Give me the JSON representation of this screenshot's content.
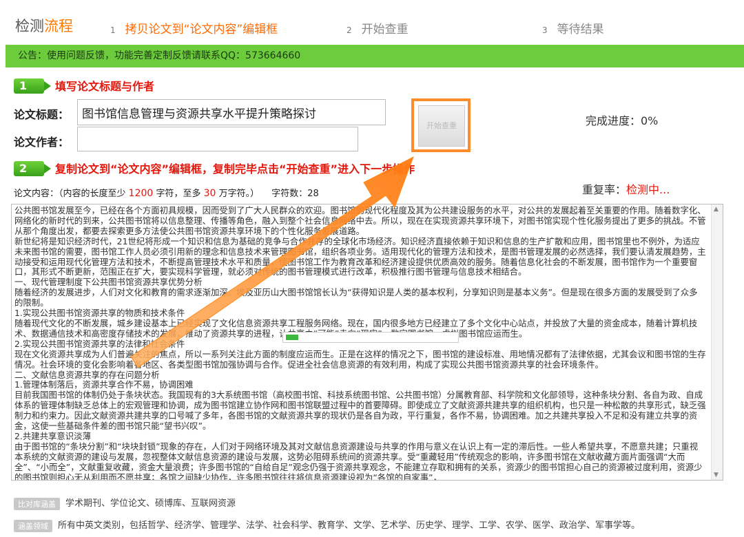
{
  "header": {
    "brand_part1": "检测",
    "brand_part2": "流程",
    "steps": [
      {
        "num": "1",
        "label": "拷贝论文到“论文内容”编辑框"
      },
      {
        "num": "2",
        "label": "开始查重"
      },
      {
        "num": "3",
        "label": "等待结果"
      }
    ]
  },
  "notice": "公告：使用问题反馈，功能完善定制反馈请联系QQ：573664660",
  "section1": {
    "num": "1",
    "title": "填写论文标题与作者"
  },
  "form": {
    "title_label": "论文标题：",
    "title_value": "图书馆信息管理与资源共享水平提升策略探讨",
    "author_label": "论文作者：",
    "author_value": ""
  },
  "start_button": "开始查重",
  "progress_text": "完成进度：0%",
  "section2": {
    "num": "2",
    "title": "复制论文到“论文内容”编辑框，复制完毕点击“开始查重”进入下一步操作"
  },
  "repeat": {
    "label": "重复率：",
    "value": "检测中..."
  },
  "content_info": {
    "prefix": "论文内容：（内容的长度至少",
    "min": "1200",
    "mid": "字符，至多",
    "max": "30",
    "suffix": "万字符。）",
    "count_label": "字符数：28"
  },
  "content_text": "公共图书馆发展至今，已经在各个方面初具规模，因而受到了广大人民群众的欢迎。图书馆的现代化程度及其为公共建设服务的水平，对公共的发展起着至关重要的作用。随着数字化、网络化的新时代的到来，公共图书馆将以信息整理、传播等角色，融入到整个社会信息网络中去。所以，现在在实现资源共享环境下，对图书馆实现个性化服务提出了更多的挑战。不管从那个角度出发，都要去探索更多方法使公共图书馆资源共享环境下的个性化服务发展道路。\n新世纪将是知识经济时代，21世纪将形成一个知识和信息为基础的竞争与合作并存的全球化市场经济。知识经济直接依赖于知识和信息的生产扩散和应用，图书馆里也不例外，为适应未来图书馆的需要，图书馆工作人员必须引用新的理念和信息技术来管理图书馆，组织各项业务。适用现代化的管理方法和技术，是图书管理发展的必然选择，我们要认清发展趋势，主动接受和运用现代化管理方法和技术，不断提高管理技术水平和质量，使图书馆工作为教育改革和经济建设提供优质高效的服务。随着信息化社会的不断发展，图书馆作为一个重要窗口，其形式不断更新，范围正在扩大，要实现科学管理，就必须对传统的图书管理模式进行改革，积极推行图书管理与信息技术相结合。\n一、现代管理制度下公共图书馆资源共享优势分析\n随着经济的发展进步，人们对文化和教育的需求逐渐加深。埃及亚历山大图书馆馆长认为“获得知识是人类的基本权利，分享知识则是基本义务”。但是现在很多方面的发展受到了众多的限制。\n1.实现公共图书馆资源共享的物质和技术条件\n随着现代文化的不断发展，城乡建设基本上已经实现了文化信息资源共享工程服务网络。现在，国内很多地方已经建立了多个文化中心站点，并投放了大量的资金成本，随着计算机技术、数据通信技术和高密度存储技术的发展，推动了资源共享的进程，让共享由“可能”走向“现实”，数字图书馆、虚拟图书馆应运而生。\n2.实现公共图书馆资源共享的法律和社会条件\n现在文化资源共享成为人们普遍关注的焦点，所以一系列关注此方面的制度应运而生。正是在这样的情况之下，图书馆的建设标准、用地情况都有了法律依据，尤其会议和图书馆的生存情况。社会环境的变化会影响着各地区、各类型图书馆加强协调与合作。促进全社会信息资源的有效利用，构成了实现公共图书馆资源共享的社会环境条件。\n二、文献信息资源共享的存在问题分析\n1.管理体制落后，资源共享合作不易，协调困难\n目前我国图书馆的体制仍处于条块状态。我国现有的3大系统图书馆（高校图书馆、科技系统图书馆、公共图书馆）分属教育部、科学院和文化部领导，这种条块分割、各自为政、自成体系的管理体制缺乏总体上的宏观管理和协调，成为图书馆建立协作网和图书馆联盟过程中的首要障碍。即使成立了文献资源共建共享的组织机构，也只是一种松散的共享形式，缺乏强制力和约束力。因此文献资源共建共享的口号喊了多年，各图书馆的文献资源共享的现状仍是各自为政，平行重复，各作不易，协调困难。加之共建共享投入不足和没有建立共享的资金，这使一些基础条件差的图书馆只能“望书兴叹”。\n2.共建共享意识淡薄\n由于图书馆的“条块分割”和“块块封锁”现象的存在，人们对于网络环境及其对文献信息资源建设与共享的作用与意义在认识上有一定的滞后性。一些人希望共享，不愿意共建；只重视本系统的文献资源的建设与发展，忽视整体文献信息资源的建设与发展，这势必阻碍系统间的资源共享。受“重藏轻用”传统观念的影响，许多图书馆在文献收藏方面片面强调“大而全”、“小而全”，文献重复收藏，资金大量浪费；许多图书馆的“自给自足”观念仍强于资源共享观念，不能建立存取和拥有的关系，资源少的图书馆担心自己的资源被过度利用，资源少的图书馆则担心无从利用而不愿共享；各馆之间缺少协作，许多图书馆往往将信息资源建设视为“各馆的自家事”，",
  "tags": [
    {
      "label": "比对库涵盖",
      "text": "学术期刊、学位论文、硕博库、互联网资源"
    },
    {
      "label": "涵盖领域",
      "text": "所有中英文类别，包括哲学、经济学、管理学、法学、社会科学、教育学、文学、艺术学、历史学、理学、工学、农学、医学、政治学、军事学等。"
    }
  ],
  "colors": {
    "accent": "#ff7a00",
    "notice_bg": "#6ccc3c",
    "red": "#e3170b"
  }
}
